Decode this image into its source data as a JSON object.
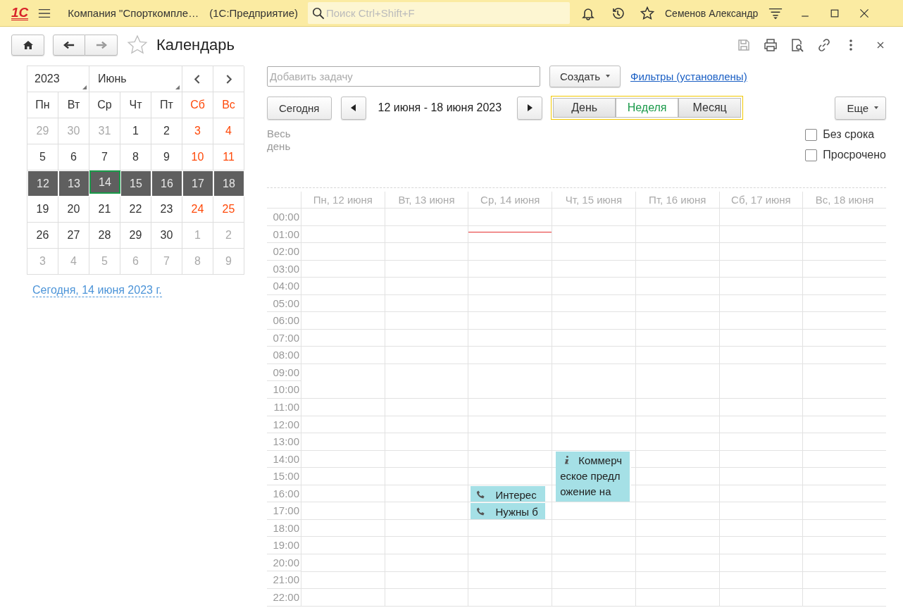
{
  "app": {
    "logo": "1С",
    "title": "Компания \"Спорткомпле…",
    "product": "(1С:Предприятие)",
    "search": {
      "placeholder": "Поиск Ctrl+Shift+F"
    },
    "user": "Семенов Александр"
  },
  "form": {
    "title": "Календарь",
    "favorite": false
  },
  "mini_calendar": {
    "year": "2023",
    "month": "Июнь",
    "weekdays": [
      {
        "label": "Пн",
        "weekend": false
      },
      {
        "label": "Вт",
        "weekend": false
      },
      {
        "label": "Ср",
        "weekend": false
      },
      {
        "label": "Чт",
        "weekend": false
      },
      {
        "label": "Пт",
        "weekend": false
      },
      {
        "label": "Сб",
        "weekend": true
      },
      {
        "label": "Вс",
        "weekend": true
      }
    ],
    "weeks": [
      {
        "selected": false,
        "days": [
          {
            "label": "29",
            "muted": true,
            "today": false
          },
          {
            "label": "30",
            "muted": true,
            "today": false
          },
          {
            "label": "31",
            "muted": true,
            "today": false
          },
          {
            "label": "1",
            "muted": false,
            "weekend": false,
            "today": false
          },
          {
            "label": "2",
            "muted": false,
            "weekend": false,
            "today": false
          },
          {
            "label": "3",
            "muted": false,
            "weekend": true,
            "today": false
          },
          {
            "label": "4",
            "muted": false,
            "weekend": true,
            "today": false
          }
        ]
      },
      {
        "selected": false,
        "days": [
          {
            "label": "5",
            "muted": false,
            "weekend": false,
            "today": false
          },
          {
            "label": "6",
            "muted": false,
            "weekend": false,
            "today": false
          },
          {
            "label": "7",
            "muted": false,
            "weekend": false,
            "today": false
          },
          {
            "label": "8",
            "muted": false,
            "weekend": false,
            "today": false
          },
          {
            "label": "9",
            "muted": false,
            "weekend": false,
            "today": false
          },
          {
            "label": "10",
            "muted": false,
            "weekend": true,
            "today": false
          },
          {
            "label": "11",
            "muted": false,
            "weekend": true,
            "today": false
          }
        ]
      },
      {
        "selected": true,
        "days": [
          {
            "label": "12",
            "today": false
          },
          {
            "label": "13",
            "today": false
          },
          {
            "label": "14",
            "today": true
          },
          {
            "label": "15",
            "today": false
          },
          {
            "label": "16",
            "today": false
          },
          {
            "label": "17",
            "today": false
          },
          {
            "label": "18",
            "today": false
          }
        ]
      },
      {
        "selected": false,
        "days": [
          {
            "label": "19",
            "muted": false,
            "weekend": false,
            "today": false
          },
          {
            "label": "20",
            "muted": false,
            "weekend": false,
            "today": false
          },
          {
            "label": "21",
            "muted": false,
            "weekend": false,
            "today": false
          },
          {
            "label": "22",
            "muted": false,
            "weekend": false,
            "today": false
          },
          {
            "label": "23",
            "muted": false,
            "weekend": false,
            "today": false
          },
          {
            "label": "24",
            "muted": false,
            "weekend": true,
            "today": false
          },
          {
            "label": "25",
            "muted": false,
            "weekend": true,
            "today": false
          }
        ]
      },
      {
        "selected": false,
        "days": [
          {
            "label": "26",
            "muted": false,
            "weekend": false,
            "today": false
          },
          {
            "label": "27",
            "muted": false,
            "weekend": false,
            "today": false
          },
          {
            "label": "28",
            "muted": false,
            "weekend": false,
            "today": false
          },
          {
            "label": "29",
            "muted": false,
            "weekend": false,
            "today": false
          },
          {
            "label": "30",
            "muted": false,
            "weekend": false,
            "today": false
          },
          {
            "label": "1",
            "muted": true,
            "today": false
          },
          {
            "label": "2",
            "muted": true,
            "today": false
          }
        ]
      },
      {
        "selected": false,
        "days": [
          {
            "label": "3",
            "muted": true,
            "today": false
          },
          {
            "label": "4",
            "muted": true,
            "today": false
          },
          {
            "label": "5",
            "muted": true,
            "today": false
          },
          {
            "label": "6",
            "muted": true,
            "today": false
          },
          {
            "label": "7",
            "muted": true,
            "today": false
          },
          {
            "label": "8",
            "muted": true,
            "today": false
          },
          {
            "label": "9",
            "muted": true,
            "today": false
          }
        ]
      }
    ],
    "today_link": "Сегодня, 14 июня 2023 г."
  },
  "toolbar": {
    "task_placeholder": "Добавить задачу",
    "create": "Создать",
    "filters_link": "Фильтры (установлены)",
    "today_button": "Сегодня",
    "period": "12 июня - 18 июня 2023",
    "views": [
      {
        "label": "День",
        "selected": false
      },
      {
        "label": "Неделя",
        "selected": true
      },
      {
        "label": "Месяц",
        "selected": false
      }
    ],
    "more": "Еще"
  },
  "all_day_label": "Весь день",
  "options": [
    {
      "label": "Без срока",
      "checked": false
    },
    {
      "label": "Просрочено",
      "checked": false
    }
  ],
  "schedule": {
    "days": [
      {
        "label": "Пн, 12 июня",
        "current": false
      },
      {
        "label": "Вт, 13 июня",
        "current": false
      },
      {
        "label": "Ср, 14 июня",
        "current": true
      },
      {
        "label": "Чт, 15 июня",
        "current": false
      },
      {
        "label": "Пт, 16 июня",
        "current": false
      },
      {
        "label": "Сб, 17 июня",
        "current": false
      },
      {
        "label": "Вс, 18 июня",
        "current": false
      }
    ],
    "rows": [
      {
        "hour": "00:00",
        "cells": [
          null,
          null,
          null,
          null,
          null,
          null,
          null
        ]
      },
      {
        "hour": "01:00",
        "cells": [
          null,
          null,
          null,
          null,
          null,
          null,
          null
        ]
      },
      {
        "hour": "02:00",
        "cells": [
          null,
          null,
          null,
          null,
          null,
          null,
          null
        ]
      },
      {
        "hour": "03:00",
        "cells": [
          null,
          null,
          null,
          null,
          null,
          null,
          null
        ]
      },
      {
        "hour": "04:00",
        "cells": [
          null,
          null,
          null,
          null,
          null,
          null,
          null
        ]
      },
      {
        "hour": "05:00",
        "cells": [
          null,
          null,
          null,
          null,
          null,
          null,
          null
        ]
      },
      {
        "hour": "06:00",
        "cells": [
          null,
          null,
          null,
          null,
          null,
          null,
          null
        ]
      },
      {
        "hour": "07:00",
        "cells": [
          null,
          null,
          null,
          null,
          null,
          null,
          null
        ]
      },
      {
        "hour": "08:00",
        "cells": [
          null,
          null,
          null,
          null,
          null,
          null,
          null
        ]
      },
      {
        "hour": "09:00",
        "cells": [
          null,
          null,
          null,
          null,
          null,
          null,
          null
        ]
      },
      {
        "hour": "10:00",
        "cells": [
          null,
          null,
          null,
          null,
          null,
          null,
          null
        ]
      },
      {
        "hour": "11:00",
        "cells": [
          null,
          null,
          null,
          null,
          null,
          null,
          null
        ]
      },
      {
        "hour": "12:00",
        "cells": [
          null,
          null,
          null,
          null,
          null,
          null,
          null
        ]
      },
      {
        "hour": "13:00",
        "cells": [
          null,
          null,
          null,
          null,
          null,
          null,
          null
        ]
      },
      {
        "hour": "14:00",
        "cells": [
          null,
          null,
          null,
          {
            "kind": "info",
            "text": "Коммерческое предложение на"
          },
          null,
          null,
          null
        ]
      },
      {
        "hour": "15:00",
        "cells": [
          null,
          null,
          null,
          {
            "kind": "continued"
          },
          null,
          null,
          null
        ]
      },
      {
        "hour": "16:00",
        "cells": [
          null,
          null,
          {
            "kind": "call",
            "text": "Интерес"
          },
          {
            "kind": "continued"
          },
          null,
          null,
          null
        ]
      },
      {
        "hour": "17:00",
        "cells": [
          null,
          null,
          {
            "kind": "call",
            "text": "Нужны б"
          },
          null,
          null,
          null,
          null
        ]
      },
      {
        "hour": "18:00",
        "cells": [
          null,
          null,
          null,
          null,
          null,
          null,
          null
        ]
      },
      {
        "hour": "19:00",
        "cells": [
          null,
          null,
          null,
          null,
          null,
          null,
          null
        ]
      },
      {
        "hour": "20:00",
        "cells": [
          null,
          null,
          null,
          null,
          null,
          null,
          null
        ]
      },
      {
        "hour": "21:00",
        "cells": [
          null,
          null,
          null,
          null,
          null,
          null,
          null
        ]
      },
      {
        "hour": "22:00",
        "cells": [
          null,
          null,
          null,
          null,
          null,
          null,
          null
        ]
      }
    ]
  }
}
